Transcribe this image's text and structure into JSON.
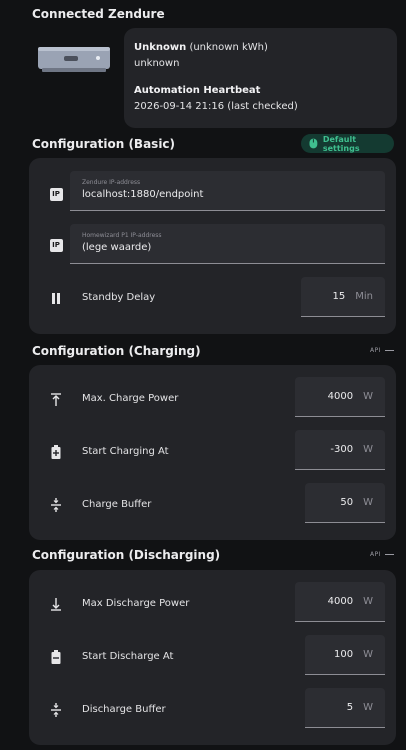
{
  "connected": {
    "title": "Connected Zendure",
    "status_bold": "Unknown",
    "status_detail": "(unknown kWh)",
    "status_sub": "unknown",
    "heartbeat_label": "Automation Heartbeat",
    "heartbeat_value": "2026-09-14 21:16 (last checked)"
  },
  "basic": {
    "title": "Configuration (Basic)",
    "default_button": "Default settings",
    "zendure_ip": {
      "icon": "ip-icon",
      "badge": "IP",
      "label": "Zendure IP-address",
      "value": "localhost:1880/endpoint"
    },
    "homewizard_ip": {
      "icon": "ip-icon",
      "badge": "IP",
      "label": "Homewizard P1 IP-address",
      "value": "(lege waarde)"
    },
    "standby": {
      "icon": "pause-icon",
      "label": "Standby Delay",
      "value": "15",
      "unit": "Min"
    }
  },
  "charging": {
    "title": "Configuration (Charging)",
    "api_tag": "API",
    "rows": [
      {
        "icon": "arrow-up-bar-icon",
        "label": "Max. Charge Power",
        "value": "4000",
        "unit": "W"
      },
      {
        "icon": "battery-plus-icon",
        "label": "Start Charging At",
        "value": "-300",
        "unit": "W"
      },
      {
        "icon": "vertical-align-center-icon",
        "label": "Charge Buffer",
        "value": "50",
        "unit": "W"
      }
    ]
  },
  "discharging": {
    "title": "Configuration (Discharging)",
    "api_tag": "API",
    "rows": [
      {
        "icon": "arrow-down-bar-icon",
        "label": "Max Discharge Power",
        "value": "4000",
        "unit": "W"
      },
      {
        "icon": "battery-minus-icon",
        "label": "Start Discharge At",
        "value": "100",
        "unit": "W"
      },
      {
        "icon": "vertical-align-center-icon",
        "label": "Discharge Buffer",
        "value": "5",
        "unit": "W"
      }
    ]
  },
  "colors": {
    "background": "#111214",
    "card": "#232428",
    "field": "#2c2d32",
    "accent_green": "#3fbf8f"
  }
}
